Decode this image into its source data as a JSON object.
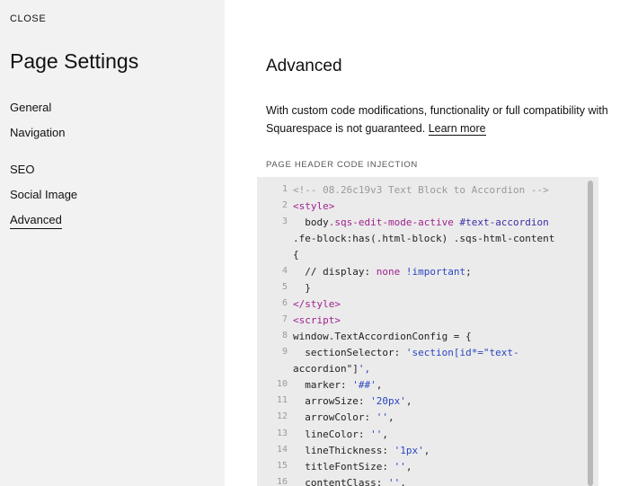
{
  "sidebar": {
    "close_label": "CLOSE",
    "title": "Page Settings",
    "items": [
      {
        "label": "General"
      },
      {
        "label": "Navigation"
      },
      {
        "label": "SEO"
      },
      {
        "label": "Social Image"
      },
      {
        "label": "Advanced",
        "active": true
      }
    ]
  },
  "main": {
    "title": "Advanced",
    "description": "With custom code modifications, functionality or full compatibility with Squarespace is not guaranteed.",
    "learn_more": "Learn more",
    "field_label": "PAGE HEADER CODE INJECTION"
  },
  "code_editor": {
    "lines": [
      {
        "num": "1",
        "text": "<!-- 08.26c19v3 Text Block to Accordion -->"
      },
      {
        "num": "2",
        "text": "<style>"
      },
      {
        "num": "3",
        "text": "  body.sqs-edit-mode-active #text-accordion"
      },
      {
        "num": "",
        "text": ".fe-block:has(.html-block) .sqs-html-content"
      },
      {
        "num": "",
        "text": "{"
      },
      {
        "num": "4",
        "text": "  // display: none !important;"
      },
      {
        "num": "5",
        "text": "  }"
      },
      {
        "num": "6",
        "text": "</style>"
      },
      {
        "num": "7",
        "text": "<script>"
      },
      {
        "num": "8",
        "text": "window.TextAccordionConfig = {"
      },
      {
        "num": "9",
        "text": "  sectionSelector: 'section[id*=\"text-"
      },
      {
        "num": "",
        "text": "accordion\"]',"
      },
      {
        "num": "10",
        "text": "  marker: '##',"
      },
      {
        "num": "11",
        "text": "  arrowSize: '20px',"
      },
      {
        "num": "12",
        "text": "  arrowColor: '',"
      },
      {
        "num": "13",
        "text": "  lineColor: '',"
      },
      {
        "num": "14",
        "text": "  lineThickness: '1px',"
      },
      {
        "num": "15",
        "text": "  titleFontSize: '',"
      },
      {
        "num": "16",
        "text": "  contentClass: '',"
      }
    ]
  }
}
